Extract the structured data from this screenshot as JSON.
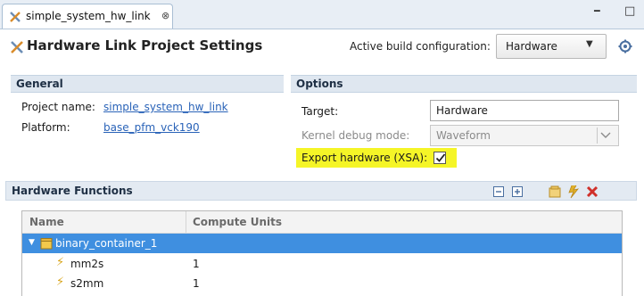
{
  "tab": {
    "title": "simple_system_hw_link",
    "close_glyph": "⊗"
  },
  "window_controls": {
    "minimize_glyph": "━",
    "maximize_glyph": "□"
  },
  "header": {
    "title": "Hardware Link Project Settings",
    "build_config_label": "Active build configuration:",
    "build_config_value": "Hardware"
  },
  "general": {
    "section_title": "General",
    "project_name_label": "Project name:",
    "project_name_value": "simple_system_hw_link",
    "platform_label": "Platform:",
    "platform_value": "base_pfm_vck190"
  },
  "options": {
    "section_title": "Options",
    "target_label": "Target:",
    "target_value": "Hardware",
    "kernel_debug_label": "Kernel debug mode:",
    "kernel_debug_value": "Waveform",
    "export_label": "Export hardware (XSA):",
    "export_checked": true,
    "highlight_color": "#f5f527"
  },
  "hardware_functions": {
    "section_title": "Hardware Functions",
    "columns": [
      "Name",
      "Compute Units"
    ],
    "container": {
      "name": "binary_container_1"
    },
    "functions": [
      {
        "name": "mm2s",
        "units": "1"
      },
      {
        "name": "s2mm",
        "units": "1"
      }
    ]
  },
  "colors": {
    "selection": "#3f8fe0",
    "link": "#2a63b8",
    "section_bg": "#dfe7f0"
  }
}
